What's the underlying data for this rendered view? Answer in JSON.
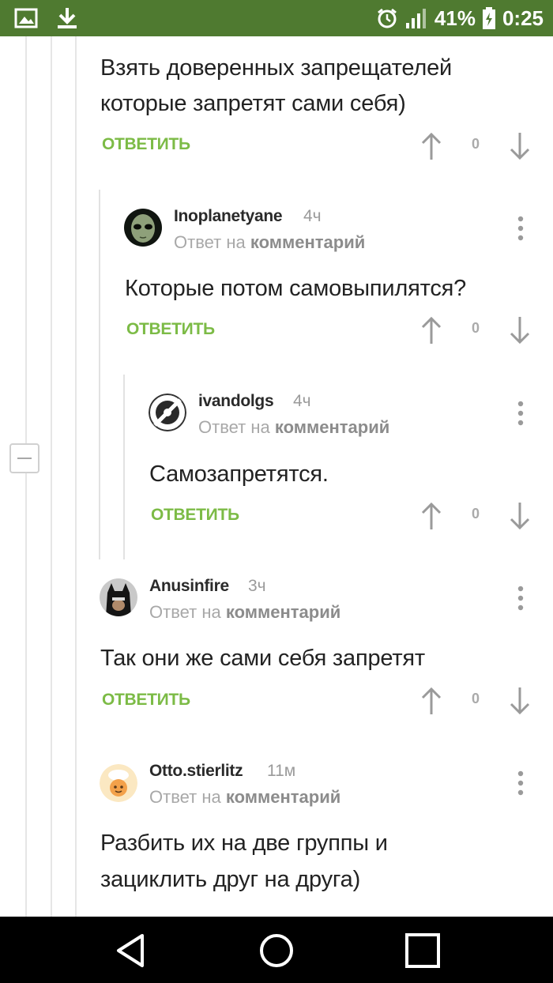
{
  "status_bar": {
    "battery": "41%",
    "time": "0:25",
    "icons": [
      "image-notification-icon",
      "download-icon",
      "alarm-icon",
      "signal-icon",
      "battery-icon"
    ]
  },
  "colors": {
    "status_bar": "#4f7a30",
    "reply_green": "#7cbb46",
    "text": "#222222",
    "muted": "#a8a8a8"
  },
  "comments": [
    {
      "text_lines": [
        "Взять доверенных запрещателей",
        "которые запретят сами себя)"
      ],
      "reply_label": "ОТВЕТИТЬ",
      "score": "0"
    },
    {
      "author": "Inoplanetyane",
      "time": "4ч",
      "reply_prefix": "Ответ на",
      "reply_target": "комментарий",
      "text": "Которые потом самовыпилятся?",
      "reply_label": "ОТВЕТИТЬ",
      "score": "0"
    },
    {
      "author": "ivandolgs",
      "time": "4ч",
      "reply_prefix": "Ответ на",
      "reply_target": "комментарий",
      "text": "Самозапретятся.",
      "reply_label": "ОТВЕТИТЬ",
      "score": "0"
    },
    {
      "author": "Anusinfire",
      "time": "3ч",
      "reply_prefix": "Ответ на",
      "reply_target": "комментарий",
      "text": "Так они же сами себя запретят",
      "reply_label": "ОТВЕТИТЬ",
      "score": "0"
    },
    {
      "author": "Otto.stierlitz",
      "time": "11м",
      "reply_prefix": "Ответ на",
      "reply_target": "комментарий",
      "text_lines": [
        "Разбить их на две группы и",
        "зациклить друг на друга)"
      ]
    }
  ],
  "nav_bar": {
    "icons": [
      "back-icon",
      "home-icon",
      "recents-icon"
    ]
  }
}
